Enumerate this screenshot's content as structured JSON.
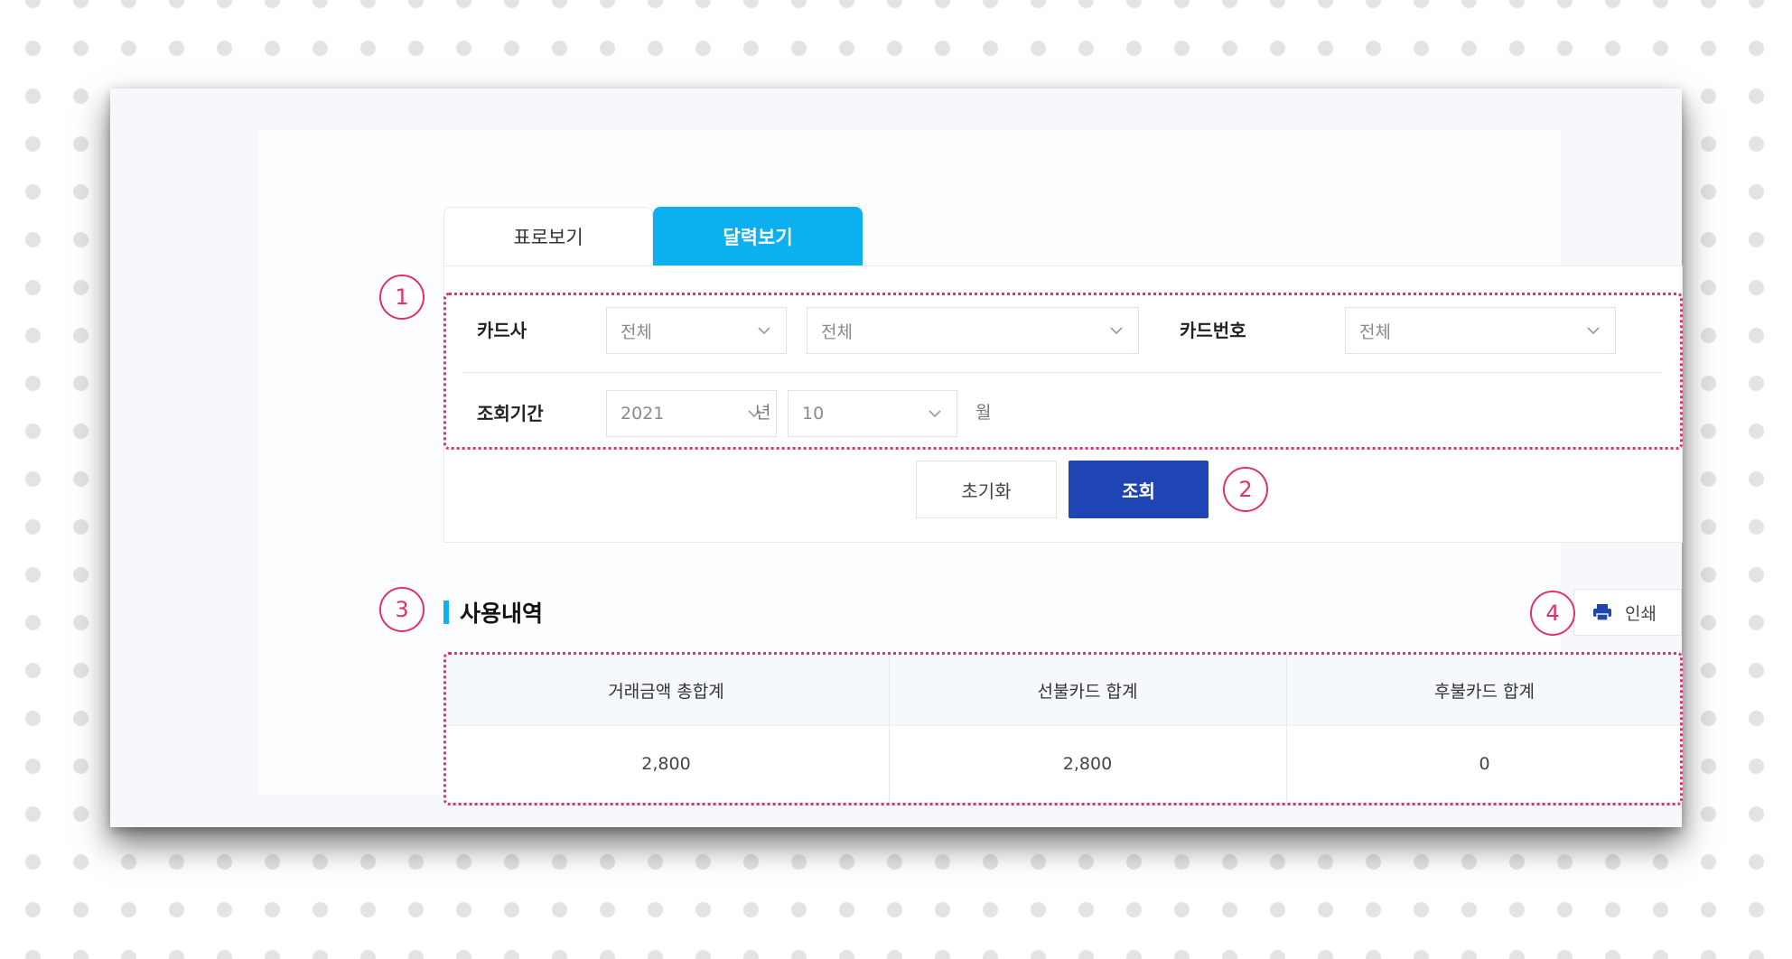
{
  "tabs": [
    {
      "label": "표로보기",
      "active": false
    },
    {
      "label": "달력보기",
      "active": true
    }
  ],
  "filters": {
    "card_company_label": "카드사",
    "card_company_value": "전체",
    "card_company_sub_value": "전체",
    "card_number_label": "카드번호",
    "card_number_value": "전체",
    "period_label": "조회기간",
    "year_value": "2021",
    "year_unit": "년",
    "month_value": "10",
    "month_unit": "월"
  },
  "buttons": {
    "reset_label": "초기화",
    "search_label": "조회"
  },
  "section": {
    "title": "사용내역",
    "print_label": "인쇄"
  },
  "summary_table": {
    "headers": [
      "거래금액 총합계",
      "선불카드 합계",
      "후불카드 합계"
    ],
    "values": [
      "2,800",
      "2,800",
      "0"
    ]
  },
  "callouts": [
    "1",
    "2",
    "3",
    "4"
  ],
  "colors": {
    "tab_active": "#0cb0ee",
    "search_button": "#1f44b3",
    "callout": "#e0306e",
    "section_accent": "#0cb0ee"
  }
}
